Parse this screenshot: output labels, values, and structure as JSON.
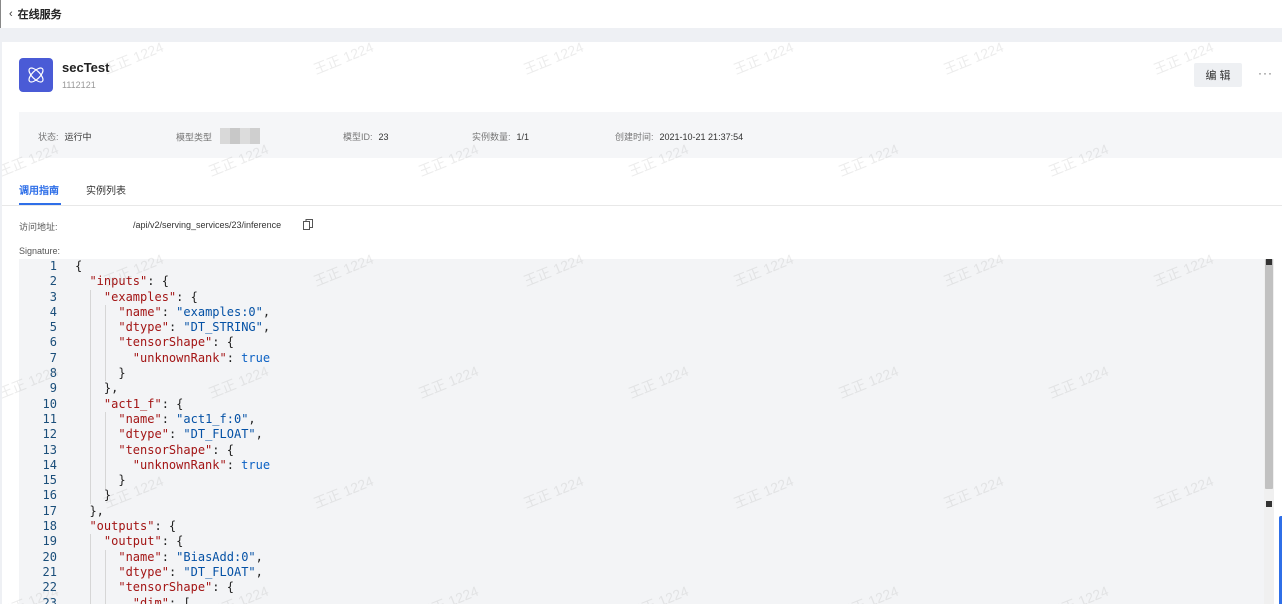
{
  "topbar": {
    "back_icon": "‹",
    "title": "在线服务"
  },
  "service": {
    "name": "secTest",
    "description": "1112121",
    "edit_label": "编 辑",
    "more_label": "···",
    "logo_color": "#4a5bd6"
  },
  "info": {
    "status_label": "状态:",
    "status_value": "运行中",
    "model_type_label": "模型类型",
    "model_id_label": "模型ID:",
    "model_id_value": "23",
    "instances_label": "实例数量:",
    "instances_value": "1/1",
    "created_label": "创建时间:",
    "created_value": "2021-10-21 21:37:54"
  },
  "tabs": [
    {
      "label": "调用指南",
      "active": true
    },
    {
      "label": "实例列表",
      "active": false
    }
  ],
  "address": {
    "label": "访问地址:",
    "value": "/api/v2/serving_services/23/inference"
  },
  "signature_label": "Signature:",
  "watermark": "王正 1224",
  "code_lines": [
    [
      [
        "p",
        "{"
      ]
    ],
    [
      [
        "p",
        "  "
      ],
      [
        "k",
        "\"inputs\""
      ],
      [
        "p",
        ": {"
      ]
    ],
    [
      [
        "p",
        "    "
      ],
      [
        "k",
        "\"examples\""
      ],
      [
        "p",
        ": {"
      ]
    ],
    [
      [
        "p",
        "      "
      ],
      [
        "k",
        "\"name\""
      ],
      [
        "p",
        ": "
      ],
      [
        "s",
        "\"examples:0\""
      ],
      [
        "p",
        ","
      ]
    ],
    [
      [
        "p",
        "      "
      ],
      [
        "k",
        "\"dtype\""
      ],
      [
        "p",
        ": "
      ],
      [
        "s",
        "\"DT_STRING\""
      ],
      [
        "p",
        ","
      ]
    ],
    [
      [
        "p",
        "      "
      ],
      [
        "k",
        "\"tensorShape\""
      ],
      [
        "p",
        ": {"
      ]
    ],
    [
      [
        "p",
        "        "
      ],
      [
        "k",
        "\"unknownRank\""
      ],
      [
        "p",
        ": "
      ],
      [
        "b",
        "true"
      ]
    ],
    [
      [
        "p",
        "      }"
      ]
    ],
    [
      [
        "p",
        "    },"
      ]
    ],
    [
      [
        "p",
        "    "
      ],
      [
        "k",
        "\"act1_f\""
      ],
      [
        "p",
        ": {"
      ]
    ],
    [
      [
        "p",
        "      "
      ],
      [
        "k",
        "\"name\""
      ],
      [
        "p",
        ": "
      ],
      [
        "s",
        "\"act1_f:0\""
      ],
      [
        "p",
        ","
      ]
    ],
    [
      [
        "p",
        "      "
      ],
      [
        "k",
        "\"dtype\""
      ],
      [
        "p",
        ": "
      ],
      [
        "s",
        "\"DT_FLOAT\""
      ],
      [
        "p",
        ","
      ]
    ],
    [
      [
        "p",
        "      "
      ],
      [
        "k",
        "\"tensorShape\""
      ],
      [
        "p",
        ": {"
      ]
    ],
    [
      [
        "p",
        "        "
      ],
      [
        "k",
        "\"unknownRank\""
      ],
      [
        "p",
        ": "
      ],
      [
        "b",
        "true"
      ]
    ],
    [
      [
        "p",
        "      }"
      ]
    ],
    [
      [
        "p",
        "    }"
      ]
    ],
    [
      [
        "p",
        "  },"
      ]
    ],
    [
      [
        "p",
        "  "
      ],
      [
        "k",
        "\"outputs\""
      ],
      [
        "p",
        ": {"
      ]
    ],
    [
      [
        "p",
        "    "
      ],
      [
        "k",
        "\"output\""
      ],
      [
        "p",
        ": {"
      ]
    ],
    [
      [
        "p",
        "      "
      ],
      [
        "k",
        "\"name\""
      ],
      [
        "p",
        ": "
      ],
      [
        "s",
        "\"BiasAdd:0\""
      ],
      [
        "p",
        ","
      ]
    ],
    [
      [
        "p",
        "      "
      ],
      [
        "k",
        "\"dtype\""
      ],
      [
        "p",
        ": "
      ],
      [
        "s",
        "\"DT_FLOAT\""
      ],
      [
        "p",
        ","
      ]
    ],
    [
      [
        "p",
        "      "
      ],
      [
        "k",
        "\"tensorShape\""
      ],
      [
        "p",
        ": {"
      ]
    ],
    [
      [
        "p",
        "        "
      ],
      [
        "k",
        "\"dim\""
      ],
      [
        "p",
        ": ["
      ]
    ]
  ]
}
